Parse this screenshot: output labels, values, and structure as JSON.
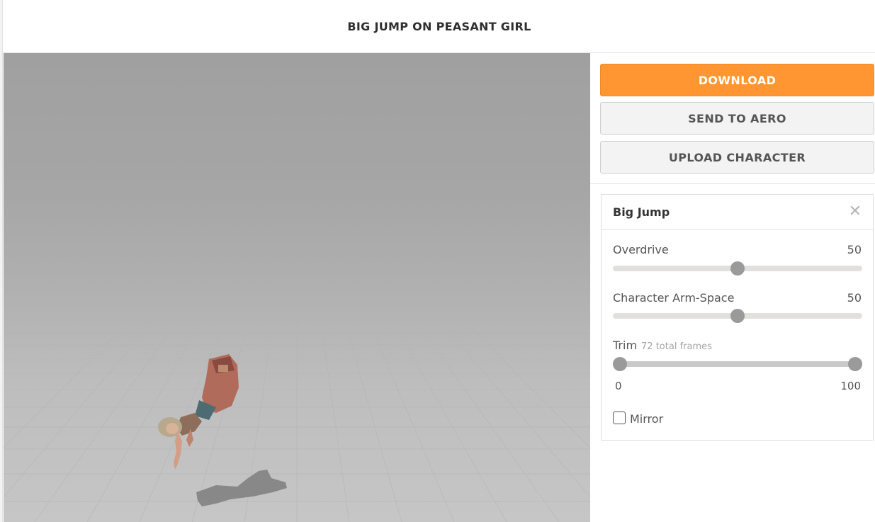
{
  "header": {
    "title": "BIG JUMP ON PEASANT GIRL"
  },
  "actions": {
    "download": "DOWNLOAD",
    "send_to_aero": "SEND TO AERO",
    "upload_character": "UPLOAD CHARACTER"
  },
  "panel": {
    "title": "Big Jump",
    "close_icon": "close-icon",
    "sliders": [
      {
        "label": "Overdrive",
        "value": "50"
      },
      {
        "label": "Character Arm-Space",
        "value": "50"
      }
    ],
    "trim": {
      "label": "Trim",
      "note": "72 total frames",
      "min": "0",
      "max": "100"
    },
    "mirror": {
      "label": "Mirror",
      "checked": false
    }
  },
  "colors": {
    "accent": "#ff9631",
    "button_bg": "#f3f3f3",
    "thumb": "#9a9a9a"
  }
}
